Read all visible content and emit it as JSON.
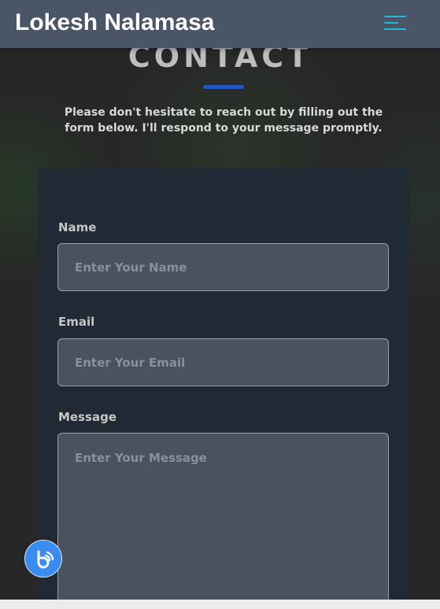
{
  "header": {
    "brand": "Lokesh Nalamasa",
    "menu_icon": "hamburger-menu-icon",
    "menu_color": "#22b8d6",
    "background": "#4a5568"
  },
  "contact": {
    "title": "CONTACT",
    "underline_color": "#2554c7",
    "subtitle": "Please don't hesitate to reach out by filling out the form below. I'll respond to your message promptly."
  },
  "form": {
    "name": {
      "label": "Name",
      "placeholder": "Enter Your Name",
      "value": ""
    },
    "email": {
      "label": "Email",
      "placeholder": "Enter Your Email",
      "value": ""
    },
    "message": {
      "label": "Message",
      "placeholder": "Enter Your Message",
      "value": ""
    }
  },
  "chat_widget": {
    "icon": "chat-bubble-icon",
    "color": "#3a8cf0"
  }
}
